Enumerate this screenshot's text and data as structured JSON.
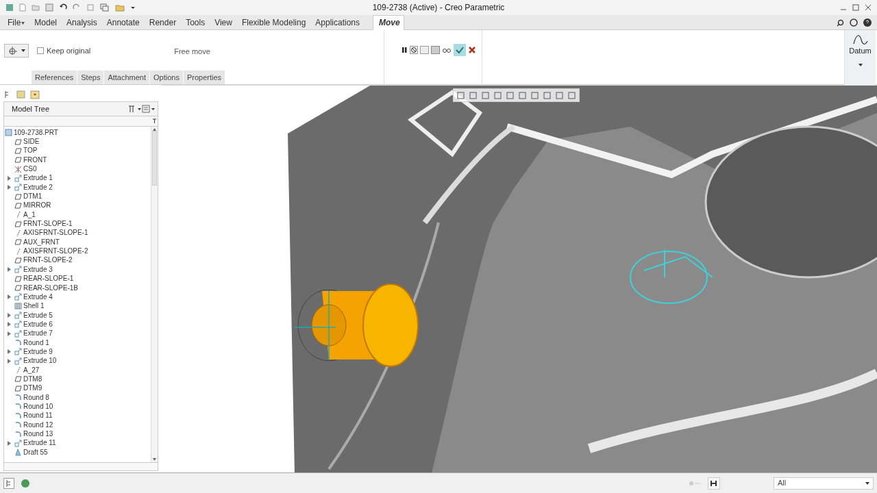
{
  "window": {
    "title": "109-2738 (Active) - Creo Parametric"
  },
  "ribbon_tabs": [
    {
      "label": "File",
      "selected": false,
      "menu": true
    },
    {
      "label": "Model",
      "selected": false,
      "menu": false
    },
    {
      "label": "Analysis",
      "selected": false,
      "menu": false
    },
    {
      "label": "Annotate",
      "selected": false,
      "menu": false
    },
    {
      "label": "Render",
      "selected": false,
      "menu": false
    },
    {
      "label": "Tools",
      "selected": false,
      "menu": false
    },
    {
      "label": "View",
      "selected": false,
      "menu": false
    },
    {
      "label": "Flexible Modeling",
      "selected": false,
      "menu": false
    },
    {
      "label": "Applications",
      "selected": false,
      "menu": false
    },
    {
      "label": "Move",
      "selected": true,
      "menu": false
    }
  ],
  "move": {
    "keep_original": {
      "label": "Keep original",
      "checked": false
    },
    "mode": "Free move"
  },
  "panel_tabs": [
    "References",
    "Steps",
    "Attachment",
    "Options",
    "Properties"
  ],
  "datum": {
    "label": "Datum"
  },
  "model_tree": {
    "title": "Model Tree",
    "root": "109-2738.PRT",
    "items": [
      {
        "kind": "plane",
        "label": "SIDE",
        "expandable": false
      },
      {
        "kind": "plane",
        "label": "TOP",
        "expandable": false
      },
      {
        "kind": "plane",
        "label": "FRONT",
        "expandable": false
      },
      {
        "kind": "csys",
        "label": "CS0",
        "expandable": false
      },
      {
        "kind": "extrude",
        "label": "Extrude 1",
        "expandable": true
      },
      {
        "kind": "extrude",
        "label": "Extrude 2",
        "expandable": true
      },
      {
        "kind": "plane",
        "label": "DTM1",
        "expandable": false
      },
      {
        "kind": "plane",
        "label": "MIRROR",
        "expandable": false
      },
      {
        "kind": "axis",
        "label": "A_1",
        "expandable": false
      },
      {
        "kind": "plane",
        "label": "FRNT-SLOPE-1",
        "expandable": false
      },
      {
        "kind": "axis",
        "label": "AXISFRNT-SLOPE-1",
        "expandable": false
      },
      {
        "kind": "plane",
        "label": "AUX_FRNT",
        "expandable": false
      },
      {
        "kind": "axis",
        "label": "AXISFRNT-SLOPE-2",
        "expandable": false
      },
      {
        "kind": "plane",
        "label": "FRNT-SLOPE-2",
        "expandable": false
      },
      {
        "kind": "extrude",
        "label": "Extrude 3",
        "expandable": true
      },
      {
        "kind": "plane",
        "label": "REAR-SLOPE-1",
        "expandable": false
      },
      {
        "kind": "plane",
        "label": "REAR-SLOPE-1B",
        "expandable": false
      },
      {
        "kind": "extrude",
        "label": "Extrude 4",
        "expandable": true
      },
      {
        "kind": "shell",
        "label": "Shell 1",
        "expandable": false
      },
      {
        "kind": "extrude",
        "label": "Extrude 5",
        "expandable": true
      },
      {
        "kind": "extrude",
        "label": "Extrude 6",
        "expandable": true
      },
      {
        "kind": "extrude",
        "label": "Extrude 7",
        "expandable": true
      },
      {
        "kind": "round",
        "label": "Round 1",
        "expandable": false
      },
      {
        "kind": "extrude",
        "label": "Extrude 9",
        "expandable": true
      },
      {
        "kind": "extrude",
        "label": "Extrude 10",
        "expandable": true
      },
      {
        "kind": "axis",
        "label": "A_27",
        "expandable": false
      },
      {
        "kind": "plane",
        "label": "DTM8",
        "expandable": false
      },
      {
        "kind": "plane",
        "label": "DTM9",
        "expandable": false
      },
      {
        "kind": "round",
        "label": "Round 8",
        "expandable": false
      },
      {
        "kind": "round",
        "label": "Round 10",
        "expandable": false
      },
      {
        "kind": "round",
        "label": "Round 11",
        "expandable": false
      },
      {
        "kind": "round",
        "label": "Round 12",
        "expandable": false
      },
      {
        "kind": "round",
        "label": "Round 13",
        "expandable": false
      },
      {
        "kind": "extrude",
        "label": "Extrude 11",
        "expandable": true
      },
      {
        "kind": "draft",
        "label": "Draft 55",
        "expandable": false
      }
    ]
  },
  "status_bar": {
    "filter": "All"
  }
}
